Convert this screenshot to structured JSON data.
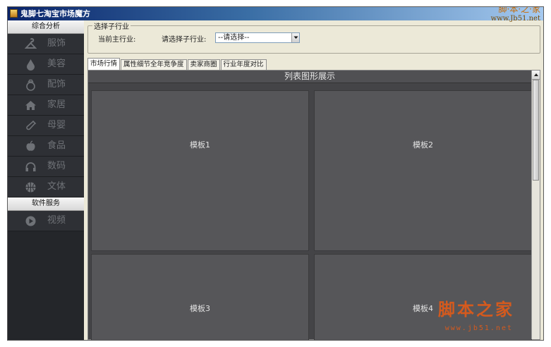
{
  "window": {
    "title": "鬼脚七淘宝市场魔方",
    "watermark_top": "脚·本·之·家",
    "watermark_top_url": "www.Jb51.net"
  },
  "sidebar": {
    "section1_title": "综合分析",
    "items": [
      {
        "label": "服饰",
        "icon": "hanger-icon"
      },
      {
        "label": "美容",
        "icon": "drop-icon"
      },
      {
        "label": "配饰",
        "icon": "ring-icon"
      },
      {
        "label": "家居",
        "icon": "house-icon"
      },
      {
        "label": "母婴",
        "icon": "bottle-icon"
      },
      {
        "label": "食品",
        "icon": "apple-icon"
      },
      {
        "label": "数码",
        "icon": "headphones-icon"
      },
      {
        "label": "文体",
        "icon": "ball-icon"
      }
    ],
    "section2_title": "软件服务",
    "items2": [
      {
        "label": "视频",
        "icon": "play-icon"
      }
    ]
  },
  "industry": {
    "group_title": "选择子行业",
    "main_label": "当前主行业:",
    "sub_label": "请选择子行业:",
    "select_value": "--请选择--"
  },
  "tabs": [
    "市场行情",
    "属性细节全年竞争度",
    "卖家商圈",
    "行业年度对比"
  ],
  "content": {
    "title": "列表图形展示",
    "panels": [
      "模板1",
      "模板2",
      "模板3",
      "模板4"
    ]
  },
  "watermark": {
    "text": "脚本之家",
    "url": "www.jb51.net"
  },
  "colors": {
    "sidebar_bg": "#24262a",
    "content_bg": "#444447",
    "panel_bg": "#565659",
    "watermark": "#d45a1e"
  }
}
